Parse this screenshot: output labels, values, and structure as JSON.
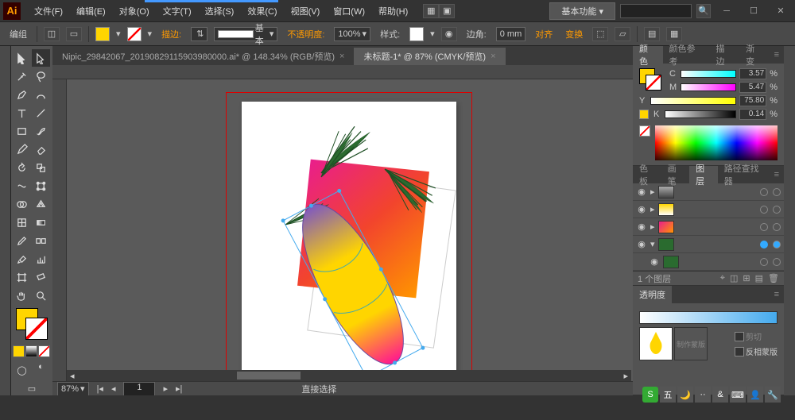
{
  "app": {
    "logo": "Ai"
  },
  "menu": {
    "file": "文件(F)",
    "edit": "编辑(E)",
    "object": "对象(O)",
    "type": "文字(T)",
    "select": "选择(S)",
    "effect": "效果(C)",
    "view": "视图(V)",
    "window": "窗口(W)",
    "help": "帮助(H)"
  },
  "workspace": {
    "label": "基本功能",
    "search_placeholder": ""
  },
  "control": {
    "group": "编组",
    "stroke_label": "描边:",
    "stroke_pt": "",
    "stroke_style": "基本",
    "opacity_label": "不透明度:",
    "opacity_val": "100%",
    "style_label": "样式:",
    "corner_label": "边角:",
    "corner_val": "0 mm",
    "align_label": "对齐",
    "transform_label": "变换"
  },
  "tabs": {
    "bg": {
      "label": "Nipic_29842067_20190829115903980000.ai* @ 148.34% (RGB/预览)"
    },
    "active": {
      "label": "未标题-1* @ 87% (CMYK/预览)"
    }
  },
  "status": {
    "zoom": "87%",
    "tool": "直接选择",
    "page": "1"
  },
  "panels": {
    "color": {
      "tab_color": "颜色",
      "tab_guide": "颜色参考",
      "tab_stroke": "描边",
      "tab_grad": "渐变",
      "c": {
        "label": "C",
        "val": "3.57"
      },
      "m": {
        "label": "M",
        "val": "5.47"
      },
      "y": {
        "label": "Y",
        "val": "75.80"
      },
      "k": {
        "label": "K",
        "val": "0.14"
      },
      "pct": "%"
    },
    "layers": {
      "tab_swatch": "色板",
      "tab_brush": "画笔",
      "tab_layers": "图层",
      "tab_path": "路径查找器",
      "footer": "1 个图层"
    },
    "trans": {
      "tab": "透明度",
      "invert": "反相蒙版"
    }
  }
}
